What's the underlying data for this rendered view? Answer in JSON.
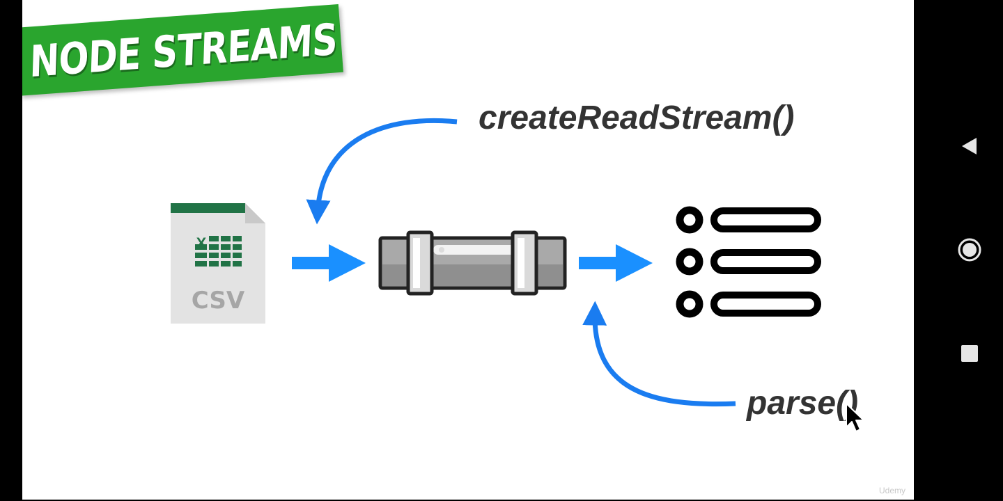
{
  "slide": {
    "banner_title": "NODE STREAMS",
    "read_label": "createReadStream()",
    "parse_label": "parse()",
    "watermark": "Udemy"
  },
  "csv_file": {
    "excel_letter": "X",
    "label": "CSV"
  },
  "colors": {
    "banner_green": "#2aa52e",
    "arrow_blue": "#1a90ff",
    "curve_blue": "#1a7cf0",
    "excel_green": "#217346",
    "file_gray": "#e3e3e3"
  },
  "icons": {
    "navigation": [
      "back-icon",
      "home-icon",
      "recents-icon"
    ],
    "diagram": [
      "csv-file-icon",
      "pipe-icon",
      "list-icon",
      "mouse-cursor-icon"
    ]
  }
}
